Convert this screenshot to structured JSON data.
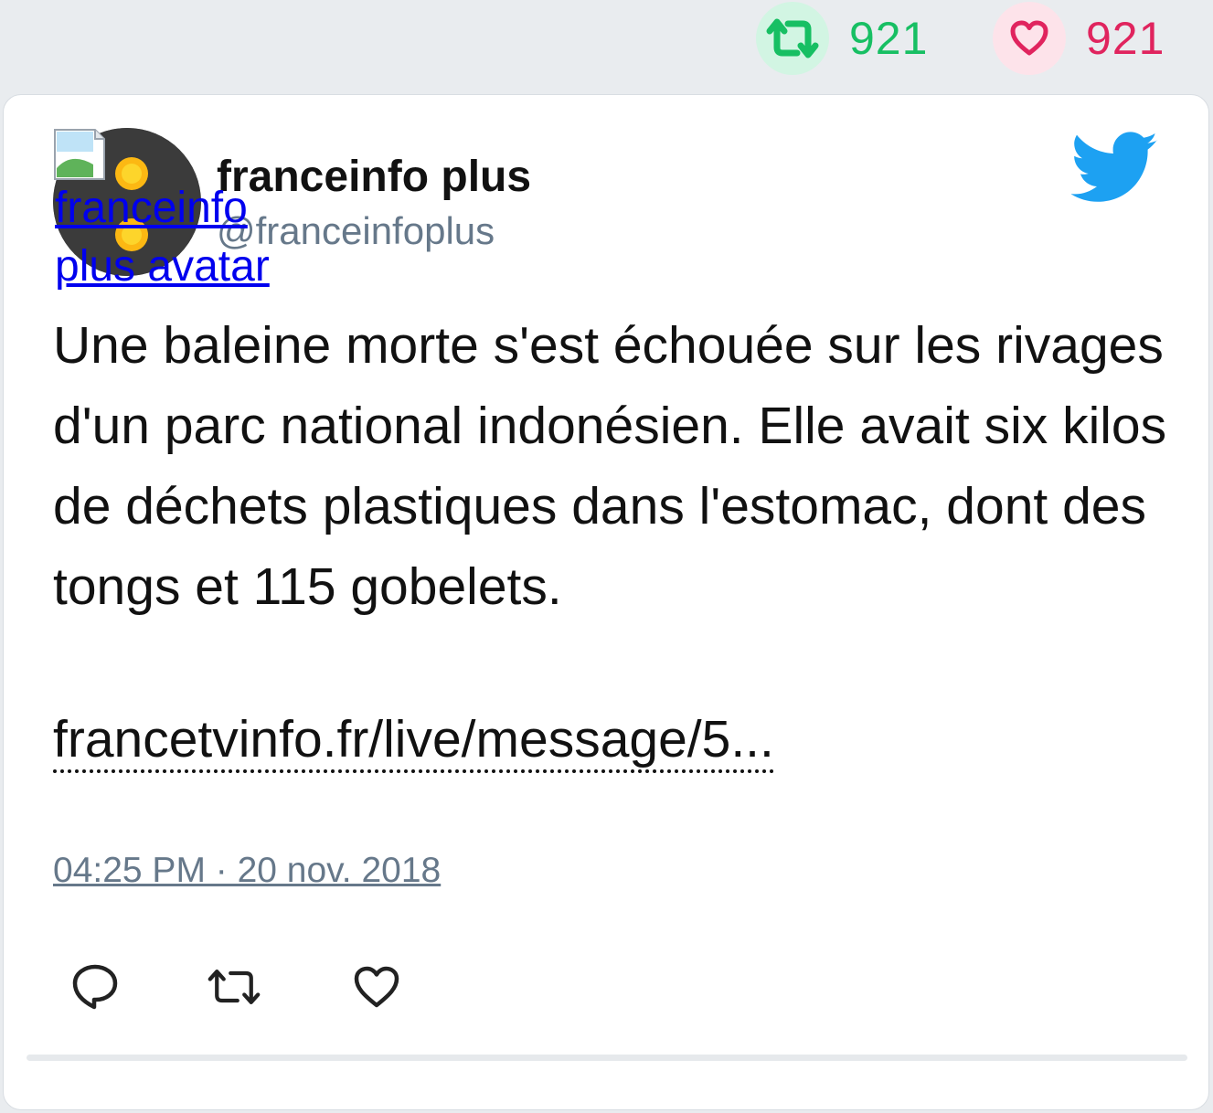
{
  "stats": {
    "retweet_count": "921",
    "like_count": "921"
  },
  "tweet": {
    "author_name": "franceinfo plus",
    "author_handle": "@franceinfoplus",
    "avatar_alt": "franceinfo plus avatar",
    "text": "Une baleine morte s'est échouée sur les rivages d'un parc national indonésien. Elle avait six kilos de déchets plastiques dans l'estomac, dont des tongs et 115 gobelets.",
    "link_text": "francetvinfo.fr/live/message/5...",
    "timestamp": "04:25 PM · 20 nov. 2018"
  },
  "colors": {
    "retweet_green": "#17bf63",
    "like_red": "#e0245e",
    "twitter_blue": "#1da1f2",
    "handle_gray": "#66788a"
  },
  "icons": {
    "top_retweet": "retweet-icon",
    "top_like": "heart-icon",
    "brand": "twitter-bird-icon",
    "reply": "reply-icon",
    "retweet": "retweet-icon",
    "like": "heart-icon"
  }
}
